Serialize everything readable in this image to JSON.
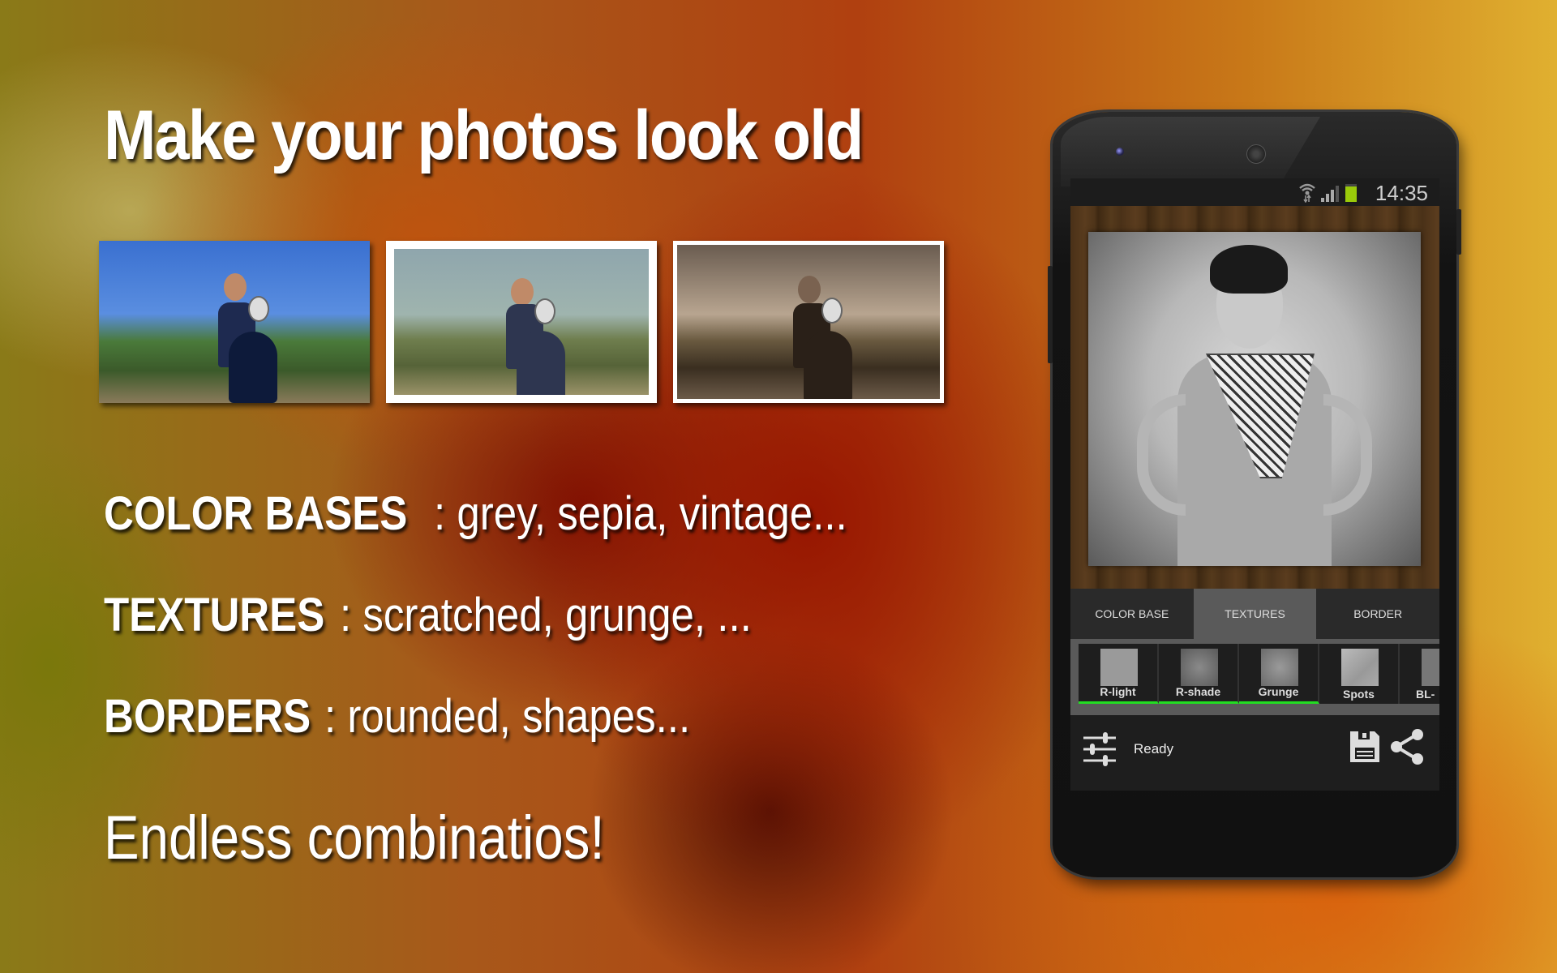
{
  "headline": "Make your photos look old",
  "photos": [
    {
      "label": "original"
    },
    {
      "label": "grunge-border"
    },
    {
      "label": "sepia"
    }
  ],
  "features": [
    {
      "key": "COLOR BASES",
      "value": ":  grey, sepia, vintage..."
    },
    {
      "key": "TEXTURES",
      "value": ":  scratched, grunge, ..."
    },
    {
      "key": "BORDERS",
      "value": ":  rounded, shapes..."
    }
  ],
  "tagline": "Endless combinatios!",
  "phone": {
    "status_bar": {
      "time": "14:35",
      "icons": [
        "wifi-icon",
        "signal-icon",
        "battery-icon"
      ],
      "battery_color": "#9acb0a"
    },
    "tabs": [
      {
        "label": "COLOR BASE",
        "active": false
      },
      {
        "label": "TEXTURES",
        "active": true
      },
      {
        "label": "BORDER",
        "active": false
      }
    ],
    "textures": [
      {
        "label": "R-light",
        "selected": true
      },
      {
        "label": "R-shade",
        "selected": true
      },
      {
        "label": "Grunge",
        "selected": true
      },
      {
        "label": "Spots",
        "selected": false
      },
      {
        "label": "BL-",
        "selected": false
      }
    ],
    "selection_color": "#22dd22",
    "bottom_bar": {
      "status": "Ready",
      "icons": [
        "adjust-sliders-icon",
        "save-icon",
        "share-icon"
      ]
    }
  }
}
